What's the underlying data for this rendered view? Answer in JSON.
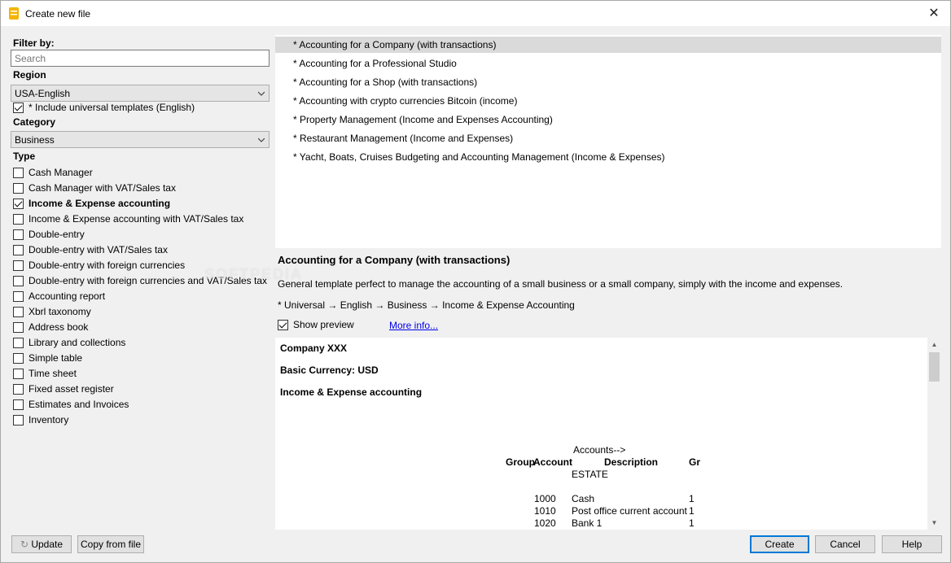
{
  "window": {
    "title": "Create new file"
  },
  "filter": {
    "label": "Filter by:",
    "search_placeholder": "Search",
    "region_label": "Region",
    "region_value": "USA-English",
    "include_universal": {
      "label": "* Include universal templates (English)",
      "checked": true
    },
    "category_label": "Category",
    "category_value": "Business",
    "type_label": "Type",
    "types": [
      {
        "label": "Cash Manager",
        "checked": false
      },
      {
        "label": "Cash Manager with VAT/Sales tax",
        "checked": false
      },
      {
        "label": "Income & Expense accounting",
        "checked": true
      },
      {
        "label": "Income & Expense accounting with VAT/Sales tax",
        "checked": false
      },
      {
        "label": "Double-entry",
        "checked": false
      },
      {
        "label": "Double-entry with VAT/Sales tax",
        "checked": false
      },
      {
        "label": "Double-entry with foreign currencies",
        "checked": false
      },
      {
        "label": "Double-entry with foreign currencies and VAT/Sales tax",
        "checked": false
      },
      {
        "label": "Accounting report",
        "checked": false
      },
      {
        "label": "Xbrl taxonomy",
        "checked": false
      },
      {
        "label": "Address book",
        "checked": false
      },
      {
        "label": "Library and collections",
        "checked": false
      },
      {
        "label": "Simple table",
        "checked": false
      },
      {
        "label": "Time sheet",
        "checked": false
      },
      {
        "label": "Fixed asset register",
        "checked": false
      },
      {
        "label": "Estimates and Invoices",
        "checked": false
      },
      {
        "label": "Inventory",
        "checked": false
      }
    ]
  },
  "templates": [
    {
      "label": "* Accounting for a Company (with transactions)",
      "selected": true
    },
    {
      "label": "* Accounting for a Professional Studio",
      "selected": false
    },
    {
      "label": "* Accounting for a Shop (with transactions)",
      "selected": false
    },
    {
      "label": "* Accounting with crypto currencies Bitcoin (income)",
      "selected": false
    },
    {
      "label": "* Property Management (Income and Expenses Accounting)",
      "selected": false
    },
    {
      "label": "* Restaurant Management (Income and Expenses)",
      "selected": false
    },
    {
      "label": "* Yacht, Boats, Cruises Budgeting and Accounting Management (Income & Expenses)",
      "selected": false
    }
  ],
  "details": {
    "title": "Accounting for a Company (with transactions)",
    "description": "General template perfect to manage the accounting of a small business or a small company, simply with the income and expenses.",
    "path": "* Universal → English → Business → Income & Expense Accounting",
    "show_preview_label": "Show preview",
    "show_preview_checked": true,
    "more_info": "More info..."
  },
  "preview": {
    "company": "Company XXX",
    "currency": "Basic Currency: USD",
    "kind": "Income & Expense accounting",
    "accounts_header": "Accounts-->",
    "col_group": "Group",
    "col_account": "Account",
    "col_description": "Description",
    "col_gr": "Gr",
    "section": "ESTATE",
    "rows": [
      {
        "account": "1000",
        "description": "Cash",
        "gr": "1"
      },
      {
        "account": "1010",
        "description": "Post office current account",
        "gr": "1"
      },
      {
        "account": "1020",
        "description": "Bank 1",
        "gr": "1"
      }
    ]
  },
  "buttons": {
    "update": "Update",
    "copy_from_file": "Copy from file",
    "create": "Create",
    "cancel": "Cancel",
    "help": "Help"
  },
  "watermark": "SOFTPEDIA",
  "colors": {
    "accent": "#0078d7",
    "selection": "#dadada",
    "link": "#0000ee"
  }
}
